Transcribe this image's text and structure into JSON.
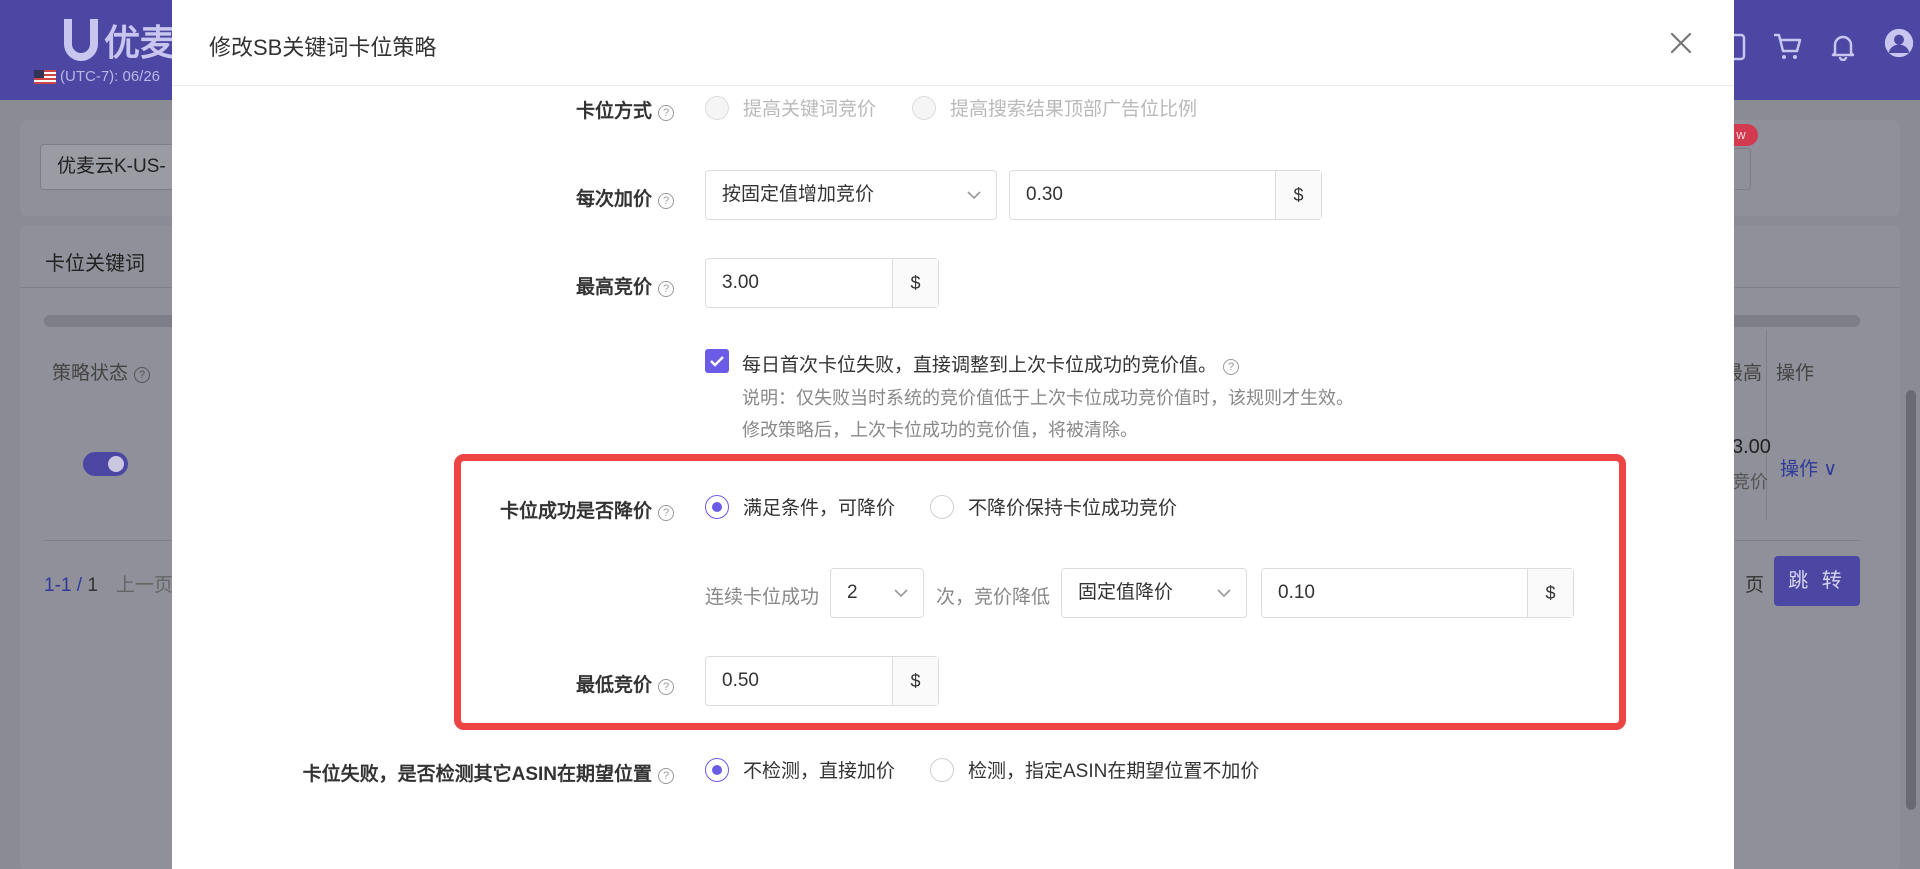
{
  "app": {
    "logo_text": "优麦",
    "timezone": "(UTC-7): 06/26",
    "store_select": "优麦云K-US-",
    "new_badge": "w",
    "section_title": "卡位关键词",
    "table": {
      "col_status": "策略状态",
      "col_max": "最高",
      "col_ops": "操作",
      "row": {
        "value": "3.00",
        "sub": "竞价",
        "ops": "操作"
      }
    },
    "pager": {
      "range": "1-1",
      "total": "1",
      "prev": "上一页",
      "page_label": "页",
      "jump": "跳 转"
    },
    "icons": [
      "document-icon",
      "cart-icon",
      "bell-icon",
      "avatar-icon"
    ]
  },
  "modal": {
    "title": "修改SB关键词卡位策略",
    "bid_method": {
      "label": "卡位方式",
      "options": [
        "提高关键词竞价",
        "提高搜索结果顶部广告位比例"
      ]
    },
    "increment": {
      "label": "每次加价",
      "select_value": "按固定值增加竞价",
      "amount": "0.30",
      "unit": "$"
    },
    "max_bid": {
      "label": "最高竞价",
      "value": "3.00",
      "unit": "$"
    },
    "daily_reset": {
      "checked": true,
      "label": "每日首次卡位失败，直接调整到上次卡位成功的竞价值。",
      "note1": "说明：仅失败当时系统的竞价值低于上次卡位成功竞价值时，该规则才生效。",
      "note2": "修改策略后，上次卡位成功的竞价值，将被清除。"
    },
    "decrease": {
      "label": "卡位成功是否降价",
      "options": [
        "满足条件，可降价",
        "不降价保持卡位成功竞价"
      ],
      "selected": 0,
      "consecutive_label": "连续卡位成功",
      "count": "2",
      "times_label": "次，竞价降低",
      "method": "固定值降价",
      "amount": "0.10",
      "unit": "$"
    },
    "min_bid": {
      "label": "最低竞价",
      "value": "0.50",
      "unit": "$"
    },
    "fail_check": {
      "label": "卡位失败，是否检测其它ASIN在期望位置",
      "options": [
        "不检测，直接加价",
        "检测，指定ASIN在期望位置不加价"
      ],
      "selected": 0
    },
    "accent_color": "#6b5ce7",
    "highlight_color": "#ef4444"
  }
}
